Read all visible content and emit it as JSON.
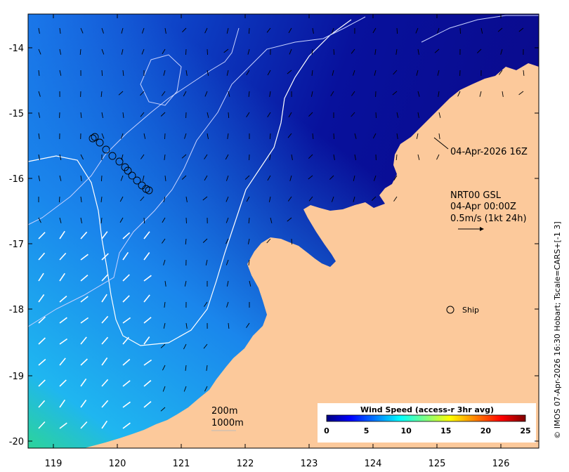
{
  "map": {
    "type": "ocean-wind-speed-map",
    "x_ticks": [
      "119",
      "120",
      "121",
      "122",
      "123",
      "124",
      "125",
      "126"
    ],
    "y_ticks": [
      "-14",
      "-15",
      "-16",
      "-17",
      "-18",
      "-19",
      "-20"
    ],
    "colors": {
      "land": "#fcc99b",
      "ocean_deep": "#0a0a8c",
      "ocean_mid": "#0f46d2",
      "ocean_light": "#1ea0f0",
      "ocean_fast": "#28d296"
    }
  },
  "annotations": {
    "drifter_time": "04-Apr-2026 16Z",
    "product_line1": "NRT00 GSL",
    "product_line2": "04-Apr 00:00Z",
    "product_line3": "0.5m/s (1kt 24h)",
    "ship_label": "Ship",
    "depth_200": "200m",
    "depth_1000": "1000m"
  },
  "colorbar": {
    "title": "Wind Speed (access-r 3hr avg)",
    "ticks": [
      "0",
      "5",
      "10",
      "15",
      "20",
      "25"
    ],
    "colors": [
      "#00007f",
      "#0000ff",
      "#0080ff",
      "#00ffff",
      "#80ff80",
      "#ffff00",
      "#ff8000",
      "#ff0000",
      "#7f0000"
    ]
  },
  "credit": "© IMOS 07-Apr-2026 16:30 Hobart; Tscale=CARS+[-1 3]"
}
